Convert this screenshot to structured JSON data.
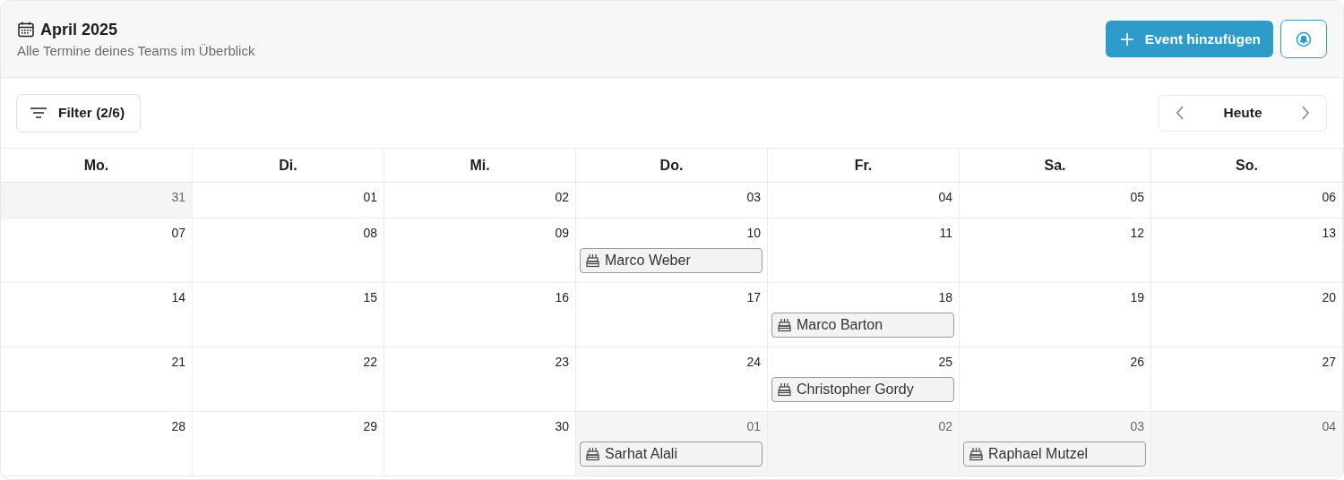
{
  "header": {
    "title": "April 2025",
    "subtitle": "Alle Termine deines Teams im Überblick",
    "add_button": "Event hinzufügen"
  },
  "toolbar": {
    "filter": "Filter (2/6)",
    "today": "Heute"
  },
  "weekdays": [
    "Mo.",
    "Di.",
    "Mi.",
    "Do.",
    "Fr.",
    "Sa.",
    "So."
  ],
  "days": [
    {
      "label": "31",
      "outside": true
    },
    {
      "label": "01",
      "outside": false
    },
    {
      "label": "02",
      "outside": false
    },
    {
      "label": "03",
      "outside": false
    },
    {
      "label": "04",
      "outside": false
    },
    {
      "label": "05",
      "outside": false
    },
    {
      "label": "06",
      "outside": false
    },
    {
      "label": "07",
      "outside": false
    },
    {
      "label": "08",
      "outside": false
    },
    {
      "label": "09",
      "outside": false
    },
    {
      "label": "10",
      "outside": false,
      "events": [
        {
          "kind": "birthday",
          "name": "Marco Weber"
        }
      ]
    },
    {
      "label": "11",
      "outside": false
    },
    {
      "label": "12",
      "outside": false
    },
    {
      "label": "13",
      "outside": false
    },
    {
      "label": "14",
      "outside": false
    },
    {
      "label": "15",
      "outside": false
    },
    {
      "label": "16",
      "outside": false
    },
    {
      "label": "17",
      "outside": false
    },
    {
      "label": "18",
      "outside": false,
      "events": [
        {
          "kind": "birthday",
          "name": "Marco Barton"
        }
      ]
    },
    {
      "label": "19",
      "outside": false
    },
    {
      "label": "20",
      "outside": false
    },
    {
      "label": "21",
      "outside": false
    },
    {
      "label": "22",
      "outside": false
    },
    {
      "label": "23",
      "outside": false
    },
    {
      "label": "24",
      "outside": false
    },
    {
      "label": "25",
      "outside": false,
      "events": [
        {
          "kind": "birthday",
          "name": "Christopher Gordy"
        }
      ]
    },
    {
      "label": "26",
      "outside": false
    },
    {
      "label": "27",
      "outside": false
    },
    {
      "label": "28",
      "outside": false
    },
    {
      "label": "29",
      "outside": false
    },
    {
      "label": "30",
      "outside": false
    },
    {
      "label": "01",
      "outside": true,
      "events": [
        {
          "kind": "birthday",
          "name": "Sarhat Alali"
        }
      ]
    },
    {
      "label": "02",
      "outside": true
    },
    {
      "label": "03",
      "outside": true,
      "events": [
        {
          "kind": "birthday",
          "name": "Raphael Mutzel"
        }
      ]
    },
    {
      "label": "04",
      "outside": true
    }
  ]
}
